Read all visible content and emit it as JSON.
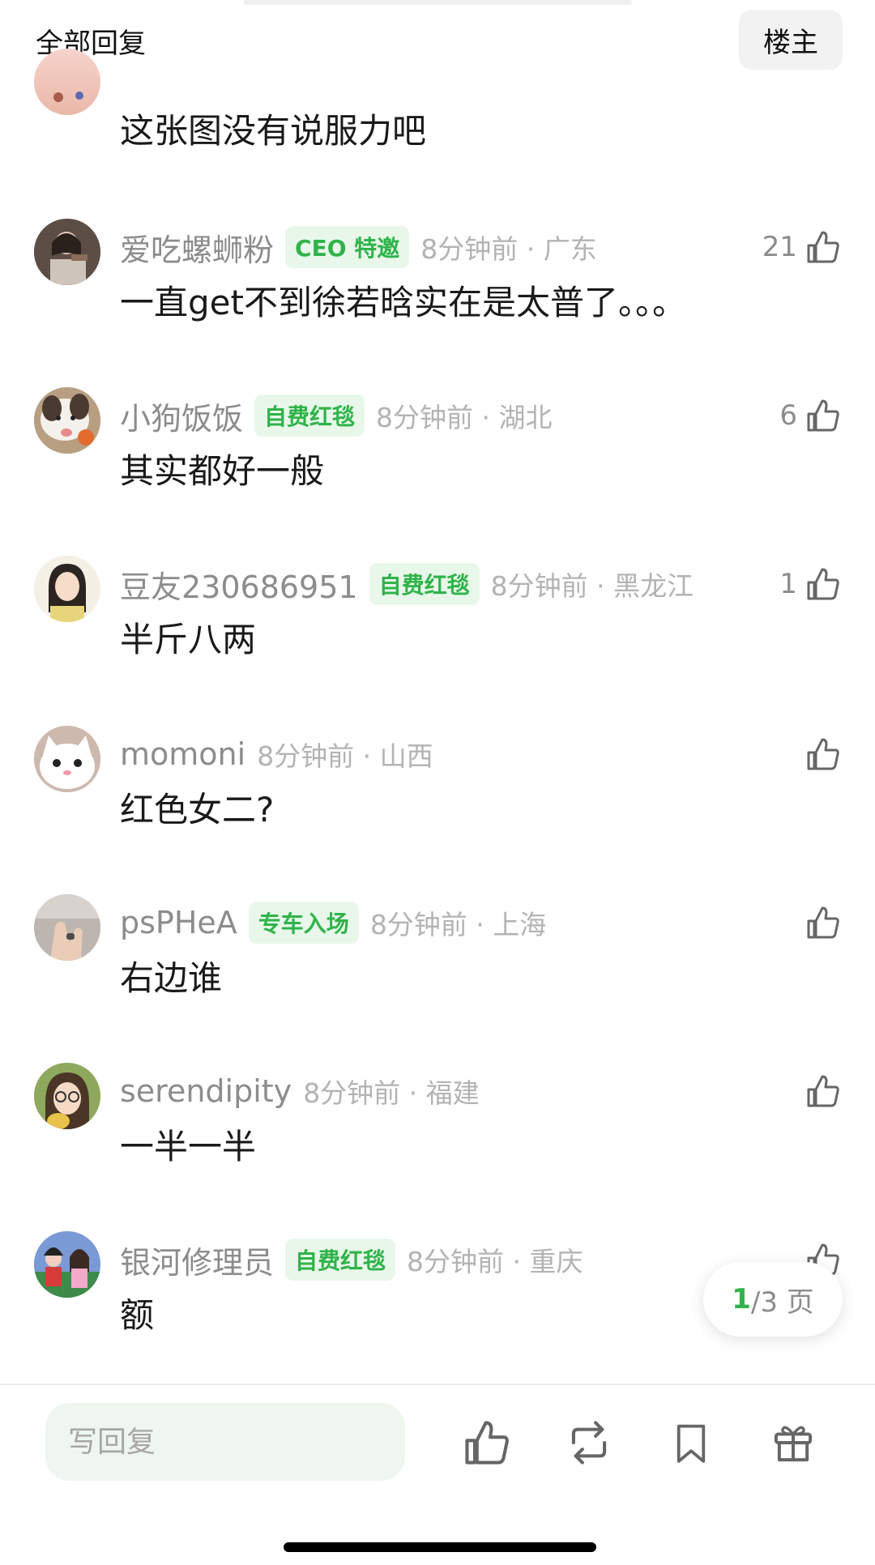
{
  "header": {
    "title": "全部回复",
    "owner_button": "楼主"
  },
  "comments": [
    {
      "username": "",
      "badge": "",
      "time": "",
      "text": "这张图没有说服力吧",
      "likes": "",
      "avatar": "avatar-partial"
    },
    {
      "username": "爱吃螺蛳粉",
      "badge": "CEO 特邀",
      "time": "8分钟前 · 广东",
      "text": "一直get不到徐若晗实在是太普了。。。",
      "likes": "21",
      "avatar": "avatar-photo"
    },
    {
      "username": "小狗饭饭",
      "badge": "自费红毯",
      "time": "8分钟前 · 湖北",
      "text": "其实都好一般",
      "likes": "6",
      "avatar": "avatar-dog"
    },
    {
      "username": "豆友230686951",
      "badge": "自费红毯",
      "time": "8分钟前 · 黑龙江",
      "text": "半斤八两",
      "likes": "1",
      "avatar": "avatar-girl"
    },
    {
      "username": "momoni",
      "badge": "",
      "time": "8分钟前 · 山西",
      "text": "红色女二?",
      "likes": "",
      "avatar": "avatar-cat"
    },
    {
      "username": "psPHeA",
      "badge": "专车入场",
      "time": "8分钟前 · 上海",
      "text": "右边谁",
      "likes": "",
      "avatar": "avatar-hand"
    },
    {
      "username": "serendipity",
      "badge": "",
      "time": "8分钟前 · 福建",
      "text": "一半一半",
      "likes": "",
      "avatar": "avatar-girl-glasses"
    },
    {
      "username": "银河修理员",
      "badge": "自费红毯",
      "time": "8分钟前 · 重庆",
      "text": "额",
      "likes": "",
      "avatar": "avatar-illustration"
    }
  ],
  "page_indicator": {
    "current": "1",
    "rest": "/3 页"
  },
  "bottom_bar": {
    "reply_placeholder": "写回复",
    "icons": [
      "like-icon",
      "repost-icon",
      "bookmark-icon",
      "gift-icon"
    ]
  },
  "colors": {
    "accent": "#2fb34a",
    "badge_bg": "#e9f7ea",
    "username": "#8c8c8c",
    "time": "#b3b3b3",
    "input_bg": "#eef6ef"
  }
}
